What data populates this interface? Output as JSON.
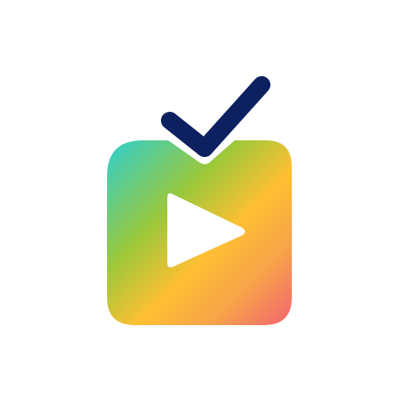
{
  "app_icon": {
    "name": "tv-checkmark-app-icon",
    "icons": [
      "tv-icon",
      "play-icon",
      "checkmark-icon"
    ],
    "colors": {
      "background": "#ffffff",
      "gradient": [
        "#2ecfcf",
        "#9cc83a",
        "#ffbf33",
        "#f7a34a",
        "#f2636f"
      ],
      "play": "#ffffff",
      "checkmark": "#0d2160"
    }
  }
}
